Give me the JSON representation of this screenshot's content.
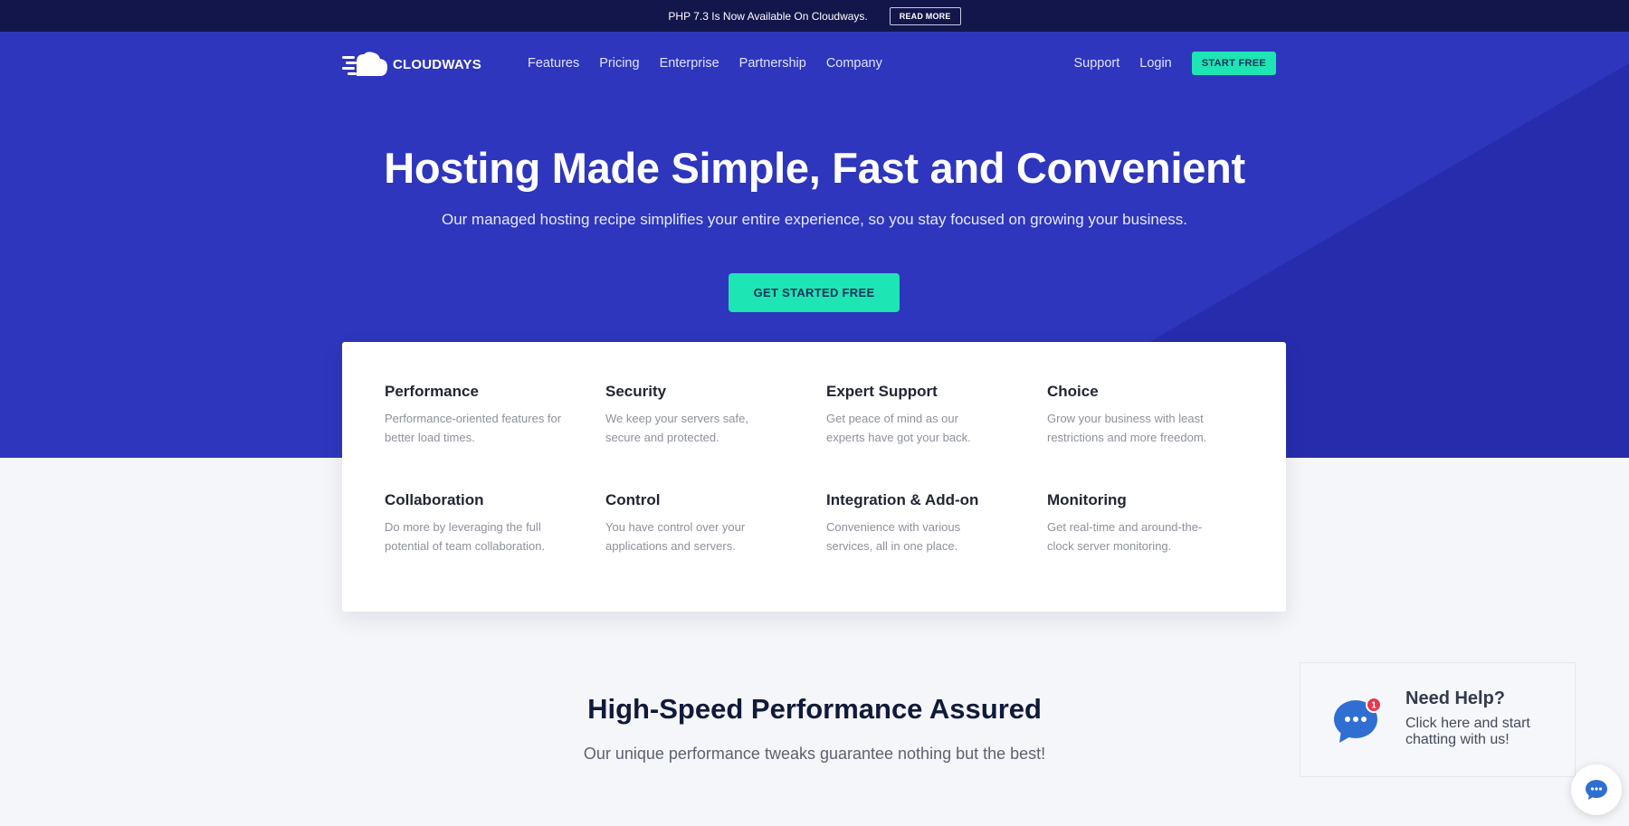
{
  "announcement": {
    "text": "PHP 7.3 Is Now Available On Cloudways.",
    "button_label": "READ MORE"
  },
  "nav": {
    "logo_text": "CLOUDWAYS",
    "links": [
      "Features",
      "Pricing",
      "Enterprise",
      "Partnership",
      "Company"
    ],
    "support_label": "Support",
    "login_label": "Login",
    "start_free_label": "START FREE"
  },
  "hero": {
    "title": "Hosting Made Simple, Fast and Convenient",
    "subtitle": "Our managed hosting recipe simplifies your entire experience, so you stay focused on growing your business.",
    "cta_label": "GET STARTED FREE"
  },
  "features": [
    {
      "title": "Performance",
      "desc": "Performance-oriented features for better load times."
    },
    {
      "title": "Security",
      "desc": "We keep your servers safe, secure and protected."
    },
    {
      "title": "Expert Support",
      "desc": "Get peace of mind as our experts have got your back."
    },
    {
      "title": "Choice",
      "desc": "Grow your business with least restrictions and more freedom."
    },
    {
      "title": "Collaboration",
      "desc": "Do more by leveraging the full potential of team collaboration."
    },
    {
      "title": "Control",
      "desc": "You have control over your applications and servers."
    },
    {
      "title": "Integration & Add-on",
      "desc": "Convenience with various services, all in one place."
    },
    {
      "title": "Monitoring",
      "desc": "Get real-time and around-the-clock server monitoring."
    }
  ],
  "section": {
    "title": "High-Speed Performance Assured",
    "subtitle": "Our unique performance tweaks guarantee nothing but the best!"
  },
  "chat": {
    "title": "Need Help?",
    "text": "Click here and start chatting with us!",
    "badge_count": "1"
  },
  "colors": {
    "hero_bg": "#2e36bd",
    "hero_shade": "#252ba8",
    "accent": "#1de5b3",
    "topbar_bg": "#13164a",
    "chat_blue": "#2f6fd1",
    "badge_red": "#e8374f"
  }
}
